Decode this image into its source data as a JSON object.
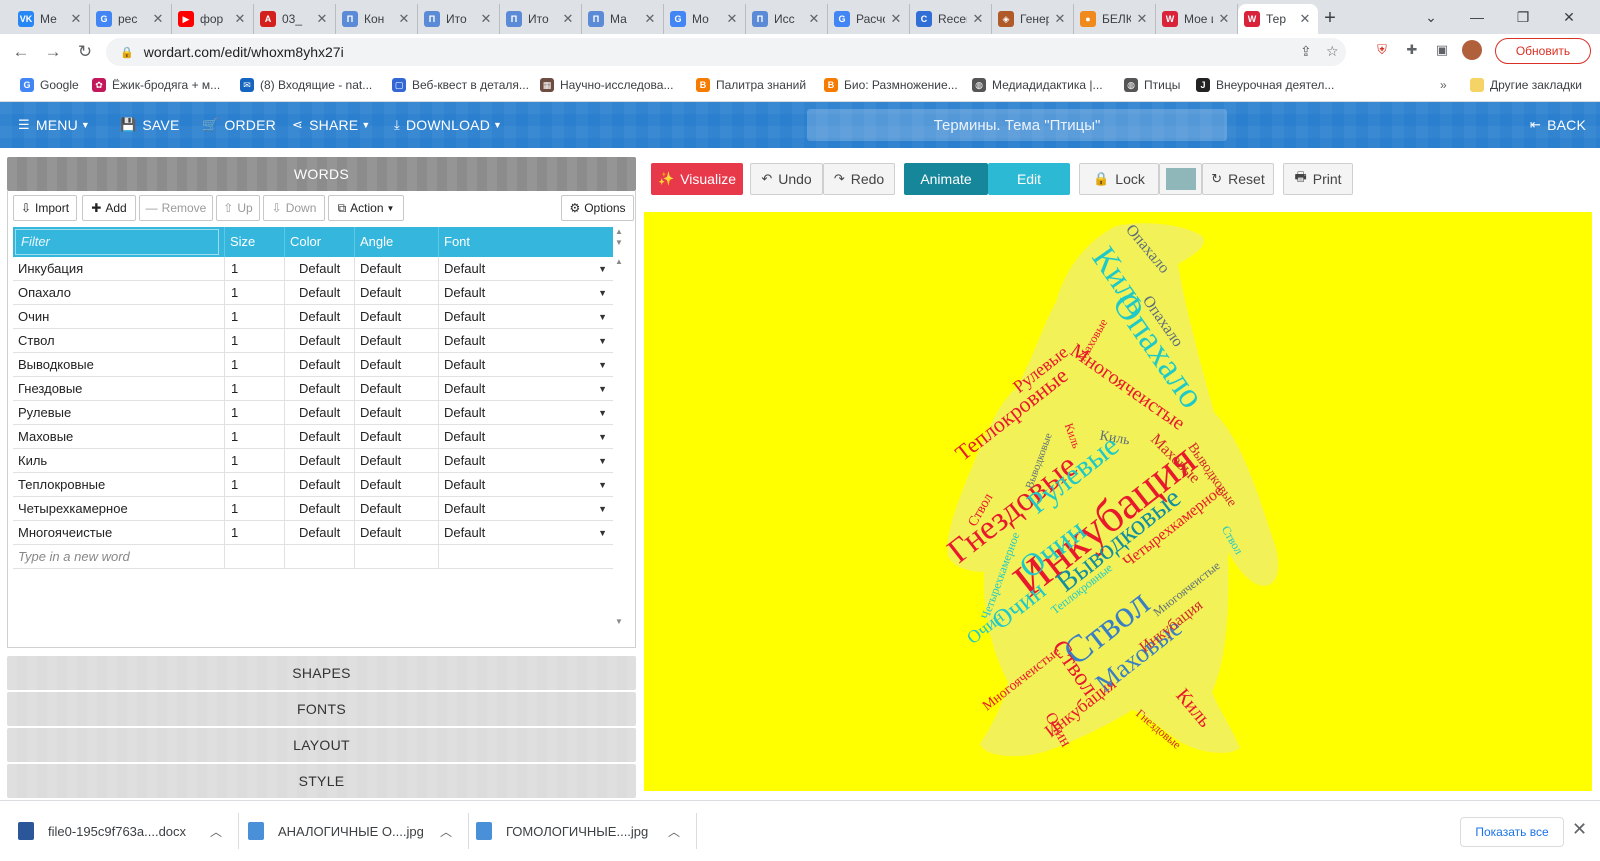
{
  "browser": {
    "tabs": [
      {
        "label": "Ме",
        "fav": "VK",
        "color": "#2787f5"
      },
      {
        "label": "рес",
        "fav": "G",
        "color": "#4285f4"
      },
      {
        "label": "фор",
        "fav": "▶",
        "color": "#ff0000"
      },
      {
        "label": "03_",
        "fav": "A",
        "color": "#d4201c"
      },
      {
        "label": "Кон",
        "fav": "П",
        "color": "#5b8bd6"
      },
      {
        "label": "Ито",
        "fav": "П",
        "color": "#5b8bd6"
      },
      {
        "label": "Ито",
        "fav": "П",
        "color": "#5b8bd6"
      },
      {
        "label": "Ма",
        "fav": "П",
        "color": "#5b8bd6"
      },
      {
        "label": "Мо",
        "fav": "G",
        "color": "#4285f4"
      },
      {
        "label": "Исс",
        "fav": "П",
        "color": "#5b8bd6"
      },
      {
        "label": "Расчов",
        "fav": "G",
        "color": "#4285f4"
      },
      {
        "label": "Recent",
        "fav": "C",
        "color": "#2f6fd6"
      },
      {
        "label": "Генерат",
        "fav": "◈",
        "color": "#b05a2a"
      },
      {
        "label": "БЕЛКИ",
        "fav": "●",
        "color": "#f08a1c"
      },
      {
        "label": "Мое ис",
        "fav": "W",
        "color": "#d9233b"
      },
      {
        "label": "Тер",
        "fav": "W",
        "color": "#d9233b"
      }
    ],
    "url": "wordart.com/edit/whoxm8yhx27i",
    "update_label": "Обновить",
    "bookmarks": [
      {
        "label": "Google",
        "fav": "G",
        "color": "#4285f4"
      },
      {
        "label": "Ёжик-бродяга + м...",
        "fav": "✿",
        "color": "#c2185b"
      },
      {
        "label": "(8) Входящие - nat...",
        "fav": "✉",
        "color": "#1565c0"
      },
      {
        "label": "Веб-квест в деталя...",
        "fav": "▢",
        "color": "#3367d6"
      },
      {
        "label": "Научно-исследова...",
        "fav": "▦",
        "color": "#6d4c41"
      },
      {
        "label": "Палитра знаний",
        "fav": "B",
        "color": "#f57c00"
      },
      {
        "label": "Био: Размножение...",
        "fav": "B",
        "color": "#f57c00"
      },
      {
        "label": "Медиадидактика |...",
        "fav": "◍",
        "color": "#555555"
      },
      {
        "label": "Птицы",
        "fav": "◍",
        "color": "#555555"
      },
      {
        "label": "Внеурочная деятел...",
        "fav": "J",
        "color": "#222222"
      }
    ],
    "other_bookmarks": "Другие закладки"
  },
  "header": {
    "menu": "MENU",
    "save": "SAVE",
    "order": "ORDER",
    "share": "SHARE",
    "download": "DOWNLOAD",
    "title": "Термины. Тема \"Птицы\"",
    "back": "BACK"
  },
  "words_panel": {
    "title": "WORDS",
    "buttons": {
      "import": "Import",
      "add": "Add",
      "remove": "Remove",
      "up": "Up",
      "down": "Down",
      "action": "Action",
      "options": "Options"
    },
    "filter_placeholder": "Filter",
    "columns": {
      "size": "Size",
      "color": "Color",
      "angle": "Angle",
      "font": "Font"
    },
    "rows": [
      {
        "word": "Инкубация",
        "size": "1",
        "color": "Default",
        "angle": "Default",
        "font": "Default"
      },
      {
        "word": "Опахало",
        "size": "1",
        "color": "Default",
        "angle": "Default",
        "font": "Default"
      },
      {
        "word": "Очин",
        "size": "1",
        "color": "Default",
        "angle": "Default",
        "font": "Default"
      },
      {
        "word": "Ствол",
        "size": "1",
        "color": "Default",
        "angle": "Default",
        "font": "Default"
      },
      {
        "word": "Выводковые",
        "size": "1",
        "color": "Default",
        "angle": "Default",
        "font": "Default"
      },
      {
        "word": "Гнездовые",
        "size": "1",
        "color": "Default",
        "angle": "Default",
        "font": "Default"
      },
      {
        "word": "Рулевые",
        "size": "1",
        "color": "Default",
        "angle": "Default",
        "font": "Default"
      },
      {
        "word": "Маховые",
        "size": "1",
        "color": "Default",
        "angle": "Default",
        "font": "Default"
      },
      {
        "word": "Киль",
        "size": "1",
        "color": "Default",
        "angle": "Default",
        "font": "Default"
      },
      {
        "word": "Теплокровные",
        "size": "1",
        "color": "Default",
        "angle": "Default",
        "font": "Default"
      },
      {
        "word": "Четырехкамерное",
        "size": "1",
        "color": "Default",
        "angle": "Default",
        "font": "Default"
      },
      {
        "word": "Многоячеистые",
        "size": "1",
        "color": "Default",
        "angle": "Default",
        "font": "Default"
      }
    ],
    "new_word_placeholder": "Type in a new word"
  },
  "sections": {
    "shapes": "SHAPES",
    "fonts": "FONTS",
    "layout": "LAYOUT",
    "style": "STYLE"
  },
  "toolbar": {
    "visualize": "Visualize",
    "undo": "Undo",
    "redo": "Redo",
    "animate": "Animate",
    "edit": "Edit",
    "lock": "Lock",
    "reset": "Reset",
    "print": "Print"
  },
  "canvas": {
    "background": "#ffff00",
    "palette": [
      "#e8192c",
      "#1fc9c7",
      "#3a7fc4",
      "#5c6f7a",
      "#cf2a2a",
      "#138f9e"
    ],
    "words": [
      {
        "text": "Инкубация",
        "color": "#e8192c"
      },
      {
        "text": "Инкубация",
        "color": "#e8192c"
      },
      {
        "text": "Ствол",
        "color": "#3a7fc4"
      },
      {
        "text": "Опахало",
        "color": "#1fc9c7"
      },
      {
        "text": "Киль",
        "color": "#1fc9c7"
      },
      {
        "text": "Гнездовые",
        "color": "#e8192c"
      },
      {
        "text": "Рулевые",
        "color": "#1fc9c7"
      },
      {
        "text": "Очин",
        "color": "#1fc9c7"
      },
      {
        "text": "Выводковые",
        "color": "#138f9e"
      },
      {
        "text": "Маховые",
        "color": "#3a7fc4"
      },
      {
        "text": "Очин",
        "color": "#1fc9c7"
      },
      {
        "text": "Ствол",
        "color": "#e8192c"
      },
      {
        "text": "Теплокровные",
        "color": "#e8192c"
      },
      {
        "text": "Многоячеистые",
        "color": "#e8192c"
      },
      {
        "text": "Рулевые",
        "color": "#e8192c"
      },
      {
        "text": "Опахало",
        "color": "#5c6f7a"
      },
      {
        "text": "Маховые",
        "color": "#cf2a2a"
      },
      {
        "text": "Очин",
        "color": "#e8192c"
      },
      {
        "text": "Четырехкамерное",
        "color": "#e8192c"
      },
      {
        "text": "Инкубация",
        "color": "#cf2a2a"
      },
      {
        "text": "Киль",
        "color": "#e8192c"
      },
      {
        "text": "Очин",
        "color": "#1fc9c7"
      },
      {
        "text": "Опахало",
        "color": "#5c6f7a"
      },
      {
        "text": "Выводковые",
        "color": "#cf2a2a"
      },
      {
        "text": "Многоячеистые",
        "color": "#e8192c"
      },
      {
        "text": "Ствол",
        "color": "#e8192c"
      },
      {
        "text": "Киль",
        "color": "#5c6f7a"
      },
      {
        "text": "Маховые",
        "color": "#e8192c"
      },
      {
        "text": "Гнездовые",
        "color": "#cf2a2a"
      },
      {
        "text": "Многоячеистые",
        "color": "#5c6f7a"
      },
      {
        "text": "Ствол",
        "color": "#1fc9c7"
      },
      {
        "text": "Теплокровные",
        "color": "#1fc9c7"
      },
      {
        "text": "Четырехкамерное",
        "color": "#1fc9c7"
      },
      {
        "text": "Киль",
        "color": "#e8192c"
      },
      {
        "text": "Выводковые",
        "color": "#5c6f7a"
      }
    ]
  },
  "downloads": [
    {
      "name": "file0-195c9f763a....docx",
      "color": "#2b579a"
    },
    {
      "name": "АНАЛОГИЧНЫЕ О....jpg",
      "color": "#4a90d9"
    },
    {
      "name": "ГОМОЛОГИЧНЫЕ....jpg",
      "color": "#4a90d9"
    }
  ],
  "show_all": "Показать все"
}
